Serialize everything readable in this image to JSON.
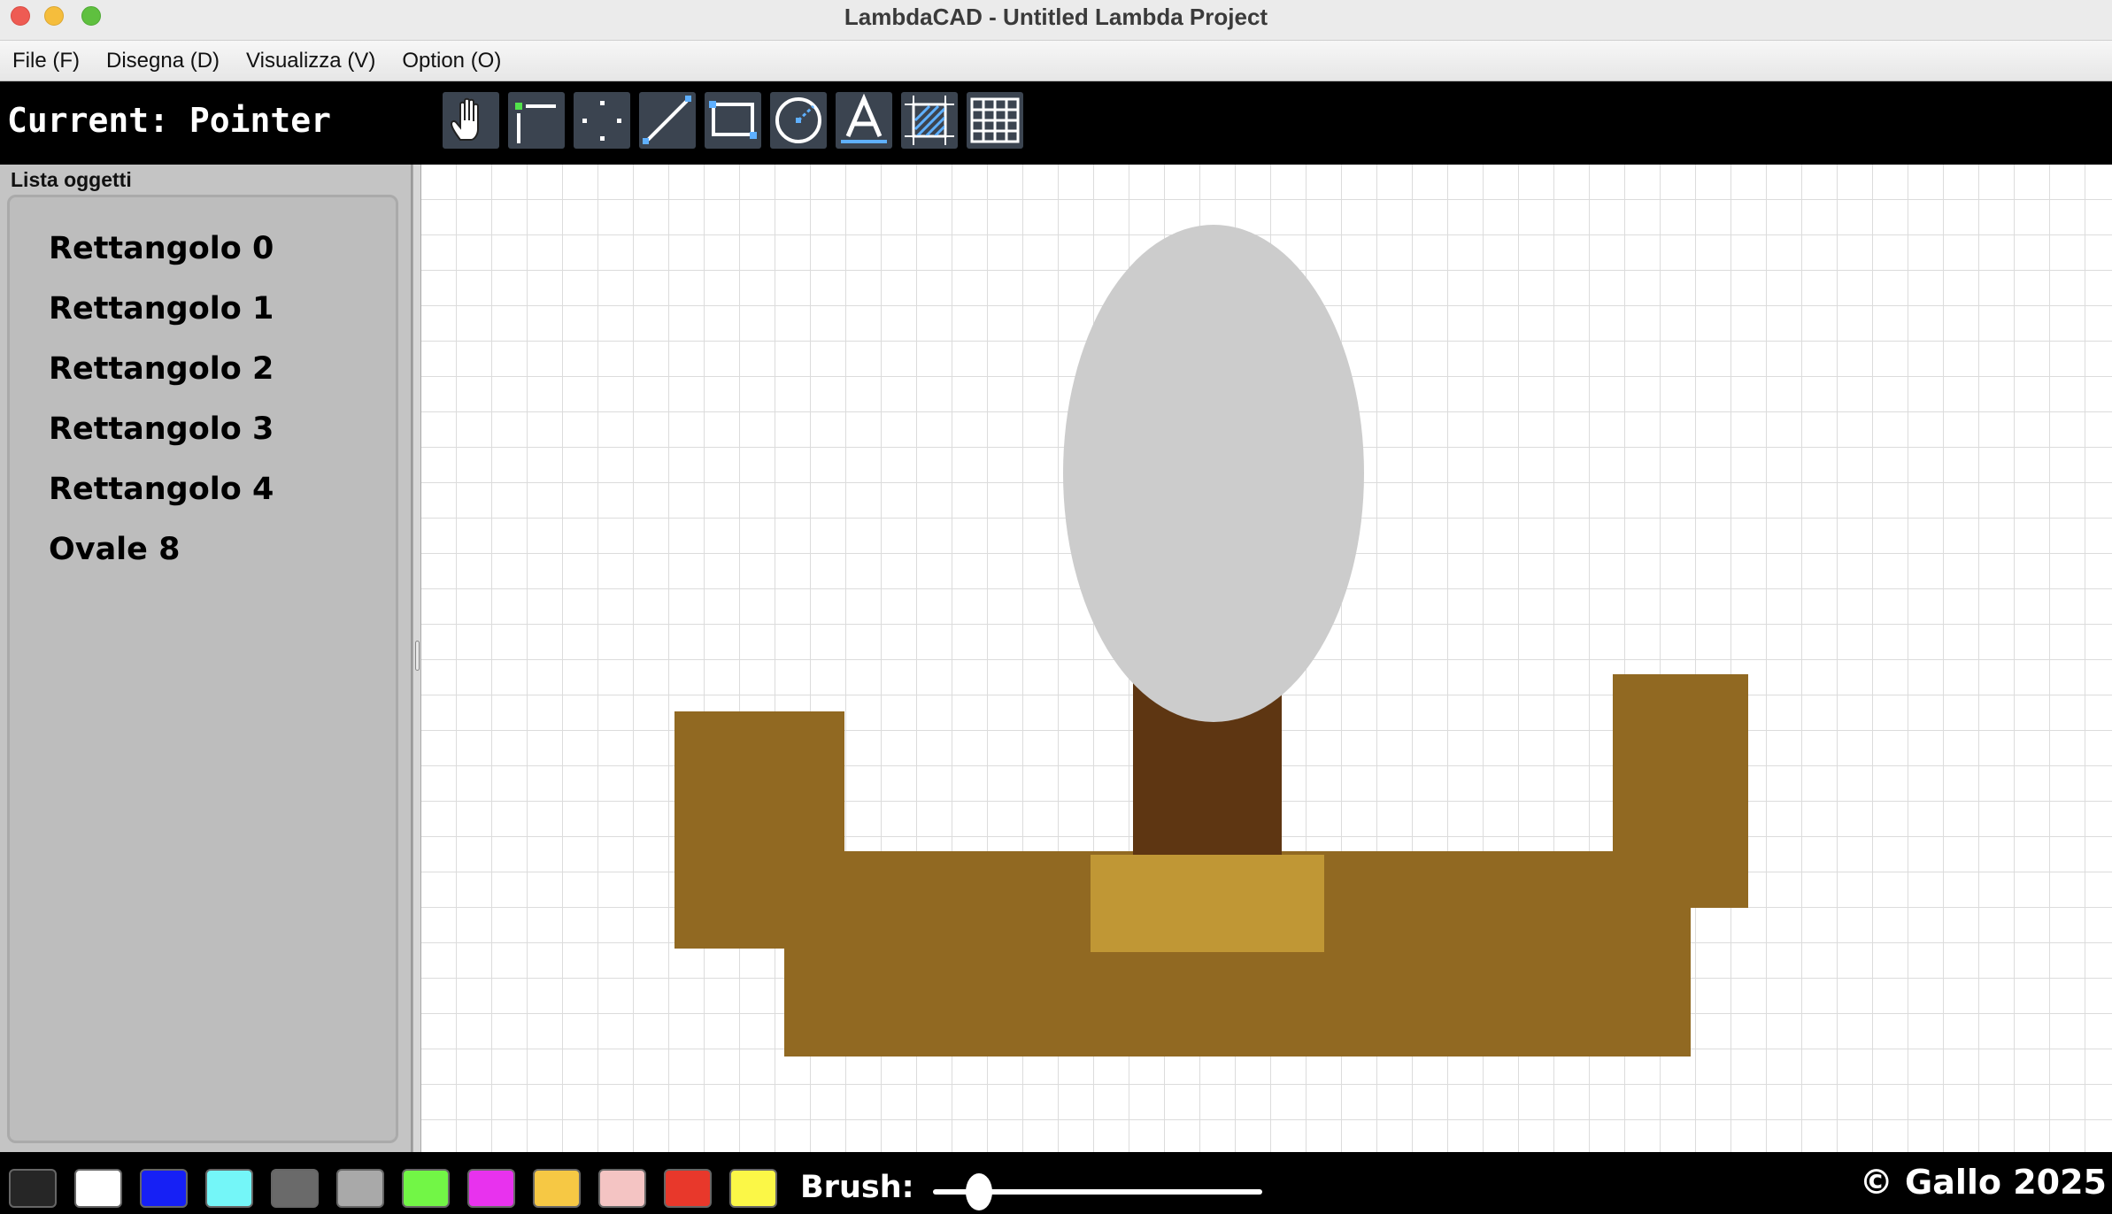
{
  "window": {
    "title": "LambdaCAD - Untitled Lambda Project"
  },
  "menu": [
    {
      "label": "File (F)"
    },
    {
      "label": "Disegna (D)"
    },
    {
      "label": "Visualizza (V)"
    },
    {
      "label": "Option (O)"
    }
  ],
  "toolbar": {
    "current": "Current: Pointer",
    "tools": [
      {
        "name": "hand-tool",
        "icon": "hand-icon"
      },
      {
        "name": "select-tool",
        "icon": "pointer-select-icon"
      },
      {
        "name": "point-tool",
        "icon": "dots-icon"
      },
      {
        "name": "line-tool",
        "icon": "line-icon"
      },
      {
        "name": "rectangle-tool",
        "icon": "rectangle-icon"
      },
      {
        "name": "circle-tool",
        "icon": "circle-icon"
      },
      {
        "name": "text-tool",
        "icon": "text-icon"
      },
      {
        "name": "hatch-tool",
        "icon": "hatch-icon"
      },
      {
        "name": "grid-tool",
        "icon": "grid-icon"
      }
    ]
  },
  "sidebar": {
    "title": "Lista oggetti",
    "items": [
      {
        "label": "Rettangolo 0"
      },
      {
        "label": "Rettangolo 1"
      },
      {
        "label": "Rettangolo 2"
      },
      {
        "label": "Rettangolo 3"
      },
      {
        "label": "Rettangolo 4"
      },
      {
        "label": "Ovale 8"
      }
    ]
  },
  "drawing": {
    "colors": {
      "brown": "#916922",
      "dark_brown": "#5e3612",
      "gold": "#c09735",
      "oval": "#cccccc"
    }
  },
  "palette": [
    {
      "name": "black",
      "color": "#262626"
    },
    {
      "name": "white",
      "color": "#ffffff"
    },
    {
      "name": "blue",
      "color": "#1620f5"
    },
    {
      "name": "cyan",
      "color": "#74f6f8"
    },
    {
      "name": "dark-gray",
      "color": "#6a6a6a"
    },
    {
      "name": "light-gray",
      "color": "#a9a9a9"
    },
    {
      "name": "green",
      "color": "#72f646"
    },
    {
      "name": "magenta",
      "color": "#e832ee"
    },
    {
      "name": "orange",
      "color": "#f6c844"
    },
    {
      "name": "pink",
      "color": "#f4c4c3"
    },
    {
      "name": "red",
      "color": "#e8382b"
    },
    {
      "name": "yellow",
      "color": "#fbf747"
    }
  ],
  "brush": {
    "label": "Brush:",
    "value_fraction": 0.14
  },
  "footer": {
    "credits": "© Gallo 2025"
  }
}
